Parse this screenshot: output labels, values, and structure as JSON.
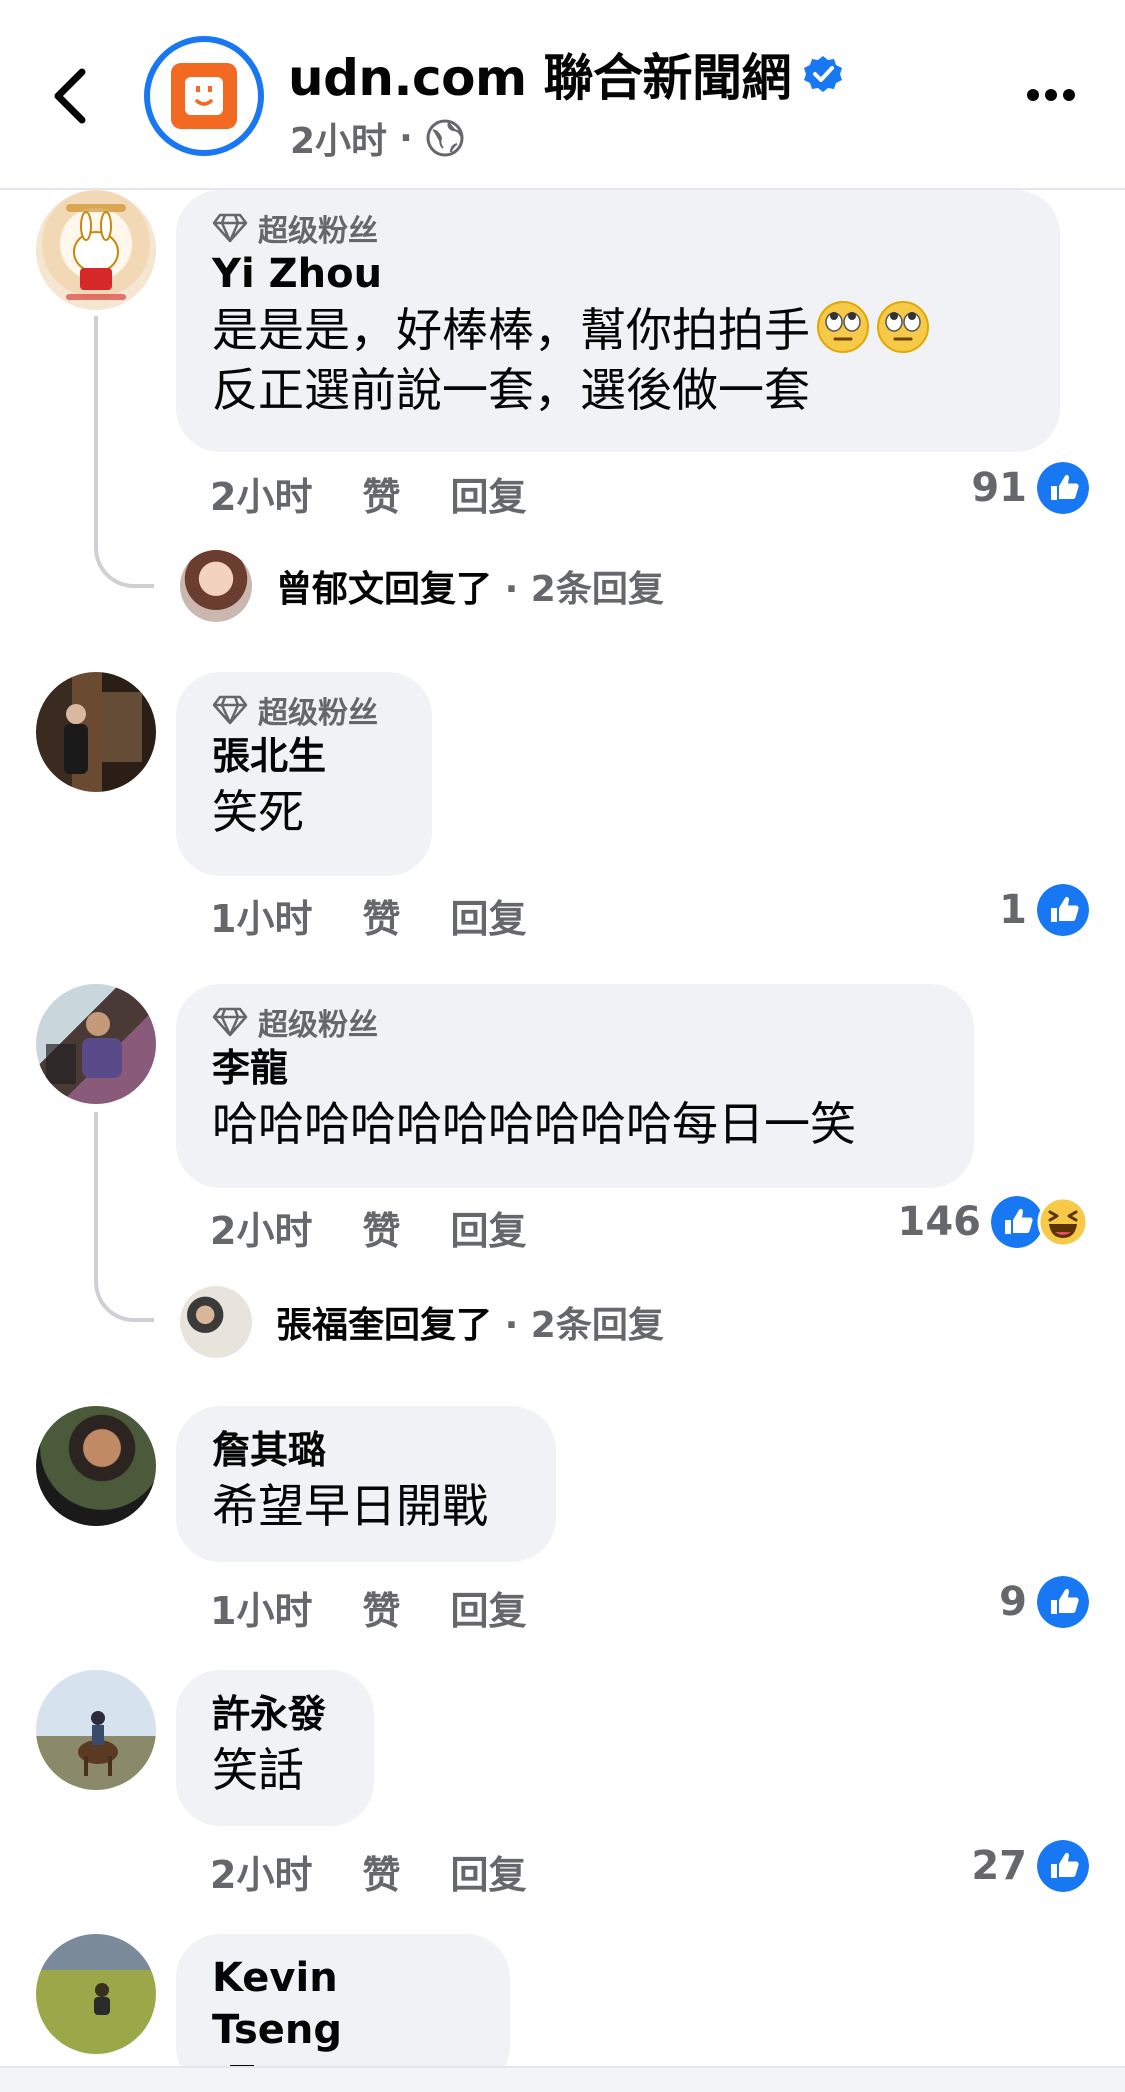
{
  "header": {
    "page_name": "udn.com 聯合新聞網",
    "post_time": "2小时",
    "separator": "·",
    "icons": [
      "back-icon",
      "verified-icon",
      "globe-icon",
      "more-icon"
    ]
  },
  "comments": [
    {
      "badge": "超级粉丝",
      "author": "Yi Zhou",
      "lines": [
        "是是是，好棒棒，幫你拍拍手",
        "反正選前說一套，選後做一套"
      ],
      "emoji": [
        "eye-roll-emoji",
        "eye-roll-emoji"
      ],
      "time": "2小时",
      "like_label": "赞",
      "reply_label": "回复",
      "reaction_count": "91",
      "reactions": [
        "like"
      ],
      "reply_summary": {
        "name_text": "曾郁文回复了",
        "count_text": "· 2条回复"
      }
    },
    {
      "badge": "超级粉丝",
      "author": "張北生",
      "lines": [
        "笑死"
      ],
      "time": "1小时",
      "like_label": "赞",
      "reply_label": "回复",
      "reaction_count": "1",
      "reactions": [
        "like"
      ]
    },
    {
      "badge": "超级粉丝",
      "author": "李龍",
      "lines": [
        "哈哈哈哈哈哈哈哈哈哈每日一笑"
      ],
      "time": "2小时",
      "like_label": "赞",
      "reply_label": "回复",
      "reaction_count": "146",
      "reactions": [
        "like",
        "haha"
      ],
      "reply_summary": {
        "name_text": "張福奎回复了",
        "count_text": "· 2条回复"
      }
    },
    {
      "author": "詹其璐",
      "lines": [
        "希望早日開戰"
      ],
      "time": "1小时",
      "like_label": "赞",
      "reply_label": "回复",
      "reaction_count": "9",
      "reactions": [
        "like"
      ]
    },
    {
      "author": "許永發",
      "lines": [
        "笑話"
      ],
      "time": "2小时",
      "like_label": "赞",
      "reply_label": "回复",
      "reaction_count": "27",
      "reactions": [
        "like"
      ]
    },
    {
      "author": "Kevin Tseng",
      "lines": [
        "喔"
      ]
    }
  ],
  "colors": {
    "accent": "#1877f2",
    "bubble": "#f0f2f5",
    "secondary_text": "#65676b",
    "brand_orange": "#f26a21"
  }
}
